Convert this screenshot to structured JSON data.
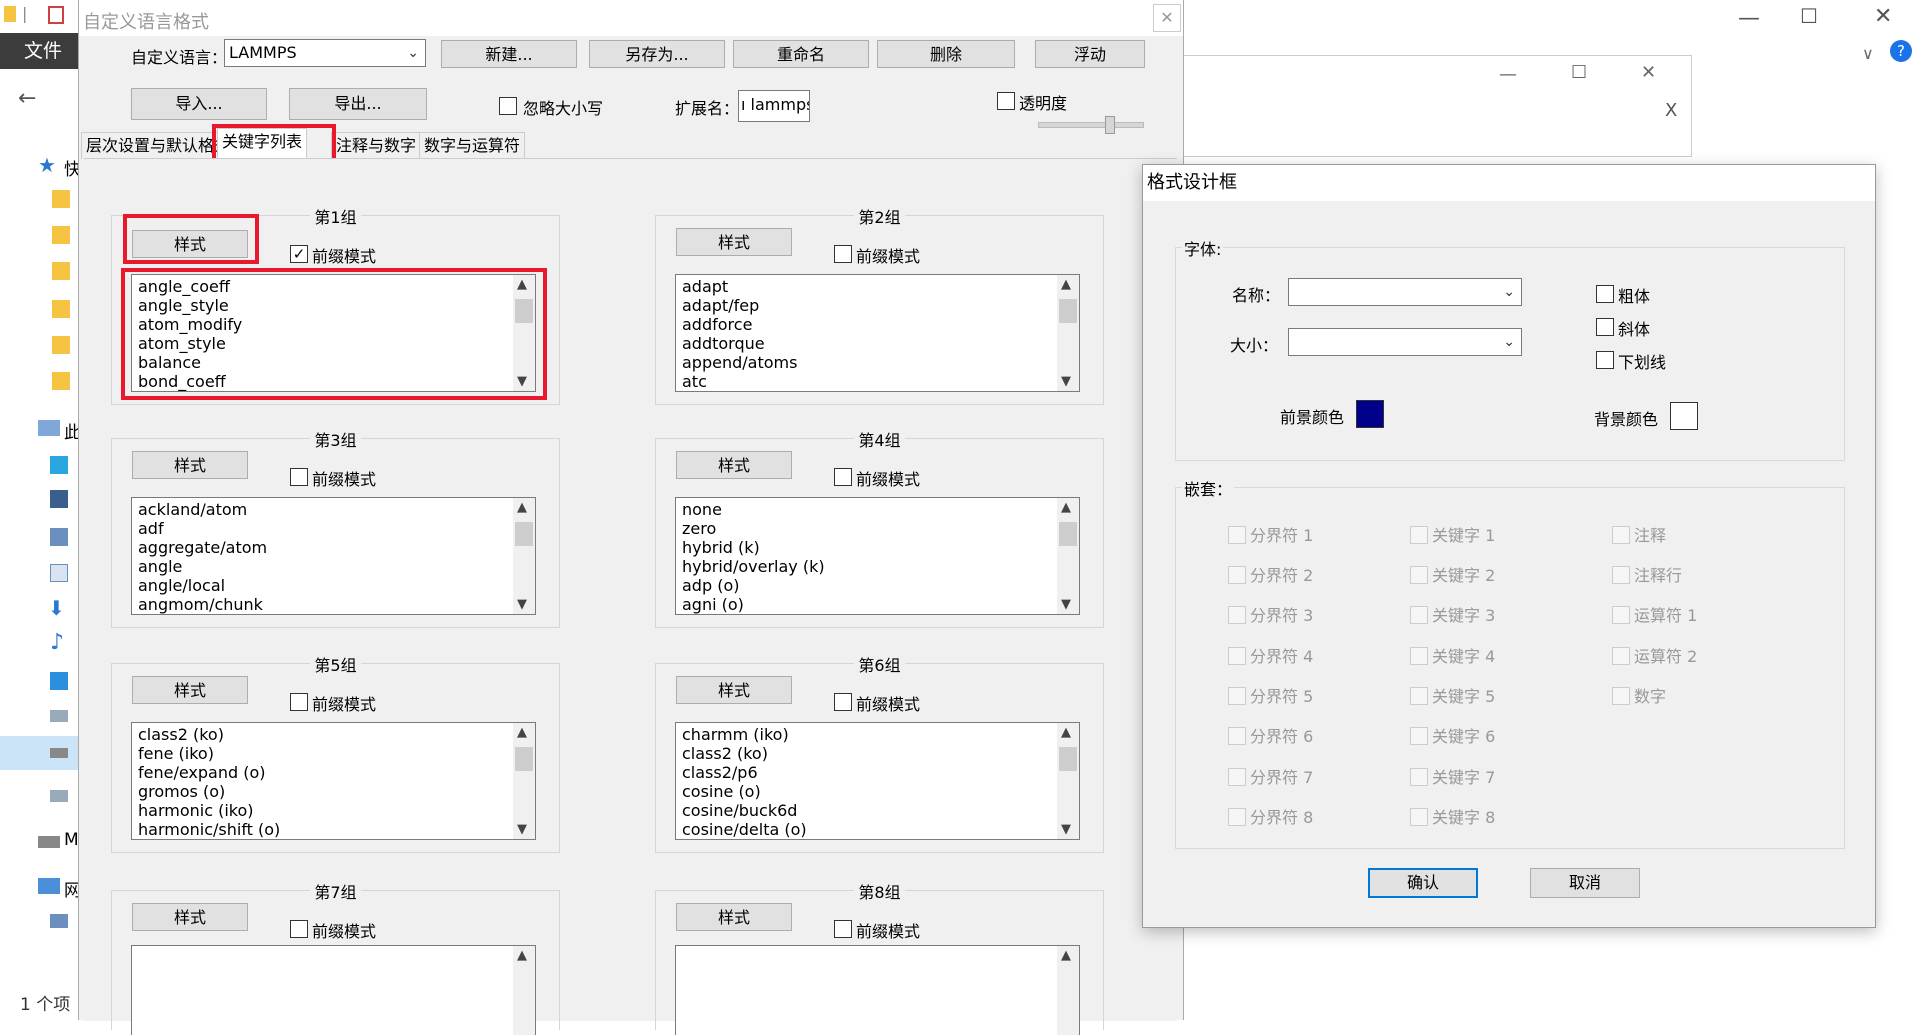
{
  "explorer": {
    "menu_file": "文件",
    "side_chars": [
      "快",
      "此",
      "M",
      "网"
    ],
    "status": "1 个项"
  },
  "bg_window": {
    "min": "—",
    "max": "☐",
    "close": "✕",
    "sub_close": "X"
  },
  "main": {
    "title": "自定义语言格式",
    "close": "✕",
    "lang_label": "自定义语言：",
    "lang_value": "LAMMPS",
    "buttons": {
      "new": "新建...",
      "save_as": "另存为...",
      "rename": "重命名",
      "delete": "删除",
      "float": "浮动",
      "import": "导入...",
      "export": "导出..."
    },
    "ignore_case": "忽略大小写",
    "ext_label": "扩展名：",
    "ext_value": "ı lammps",
    "transparency": "透明度",
    "tabs": [
      "层次设置与默认格式",
      "关键字列表",
      "注释与数字",
      "数字与运算符"
    ],
    "groups": [
      {
        "title": "第1组",
        "style": "样式",
        "prefix": "前缀模式",
        "prefix_checked": true,
        "items": [
          "angle_coeff",
          "angle_style",
          "atom_modify",
          "atom_style",
          "balance",
          "bond_coeff"
        ]
      },
      {
        "title": "第2组",
        "style": "样式",
        "prefix": "前缀模式",
        "prefix_checked": false,
        "items": [
          "adapt",
          "adapt/fep",
          "addforce",
          "addtorque",
          "append/atoms",
          "atc"
        ]
      },
      {
        "title": "第3组",
        "style": "样式",
        "prefix": "前缀模式",
        "prefix_checked": false,
        "items": [
          "ackland/atom",
          "adf",
          "aggregate/atom",
          "angle",
          "angle/local",
          "angmom/chunk"
        ]
      },
      {
        "title": "第4组",
        "style": "样式",
        "prefix": "前缀模式",
        "prefix_checked": false,
        "items": [
          "none",
          "zero",
          "hybrid (k)",
          "hybrid/overlay (k)",
          "adp (o)",
          "agni (o)"
        ]
      },
      {
        "title": "第5组",
        "style": "样式",
        "prefix": "前缀模式",
        "prefix_checked": false,
        "items": [
          "class2 (ko)",
          "fene (iko)",
          "fene/expand (o)",
          "gromos (o)",
          "harmonic (iko)",
          "harmonic/shift (o)"
        ]
      },
      {
        "title": "第6组",
        "style": "样式",
        "prefix": "前缀模式",
        "prefix_checked": false,
        "items": [
          "charmm (iko)",
          "class2 (ko)",
          "class2/p6",
          "cosine (o)",
          "cosine/buck6d",
          "cosine/delta (o)"
        ]
      },
      {
        "title": "第7组",
        "style": "样式",
        "prefix": "前缀模式",
        "prefix_checked": false,
        "items": []
      },
      {
        "title": "第8组",
        "style": "样式",
        "prefix": "前缀模式",
        "prefix_checked": false,
        "items": []
      }
    ]
  },
  "format_dialog": {
    "title": "格式设计框",
    "font_legend": "字体:",
    "name_label": "名称：",
    "size_label": "大小：",
    "bold": "粗体",
    "italic": "斜体",
    "underline": "下划线",
    "fg_label": "前景颜色",
    "bg_label": "背景颜色",
    "fg_color": "#00008b",
    "bg_color": "#ffffff",
    "nest_legend": "嵌套：",
    "nest_col1": [
      "分界符 1",
      "分界符 2",
      "分界符 3",
      "分界符 4",
      "分界符 5",
      "分界符 6",
      "分界符 7",
      "分界符 8"
    ],
    "nest_col2": [
      "关键字 1",
      "关键字 2",
      "关键字 3",
      "关键字 4",
      "关键字 5",
      "关键字 6",
      "关键字 7",
      "关键字 8"
    ],
    "nest_col3": [
      "注释",
      "注释行",
      "运算符 1",
      "运算符 2",
      "数字"
    ],
    "ok": "确认",
    "cancel": "取消"
  },
  "colors": {
    "highlight": "#e8192c",
    "accent": "#0078d7"
  }
}
